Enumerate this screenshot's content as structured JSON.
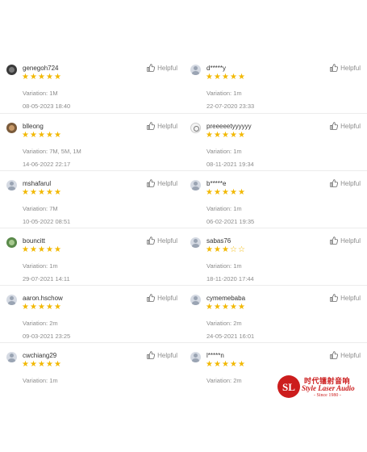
{
  "helpful_label": "Helpful",
  "star_color": "#f2b800",
  "reviews": [
    {
      "username": "genegoh724",
      "rating": 5,
      "variation": "Variation: 1M",
      "date": "08-05-2023 18:40",
      "avatar": "photo-avatar"
    },
    {
      "username": "d*****y",
      "rating": 5,
      "variation": "Variation: 1m",
      "date": "22-07-2020 23:33",
      "avatar": "default-avatar"
    },
    {
      "username": "blleong",
      "rating": 5,
      "variation": "Variation: 7M, 5M, 1M",
      "date": "14-06-2022 22:17",
      "avatar": "photo-avatar"
    },
    {
      "username": "preeeeetyyyyyy",
      "rating": 5,
      "variation": "Variation: 1m",
      "date": "08-11-2021 19:34",
      "avatar": "sketch-avatar"
    },
    {
      "username": "mshafarul",
      "rating": 5,
      "variation": "Variation: 7M",
      "date": "10-05-2022 08:51",
      "avatar": "default-avatar"
    },
    {
      "username": "b*****e",
      "rating": 5,
      "variation": "Variation: 1m",
      "date": "06-02-2021 19:35",
      "avatar": "default-avatar"
    },
    {
      "username": "bouncitt",
      "rating": 5,
      "variation": "Variation: 1m",
      "date": "29-07-2021 14:11",
      "avatar": "photo-avatar"
    },
    {
      "username": "sabas76",
      "rating": 3,
      "variation": "Variation: 1m",
      "date": "18-11-2020 17:44",
      "avatar": "default-avatar"
    },
    {
      "username": "aaron.hschow",
      "rating": 5,
      "variation": "Variation: 2m",
      "date": "09-03-2021 23:25",
      "avatar": "default-avatar"
    },
    {
      "username": "cymemebaba",
      "rating": 5,
      "variation": "Variation: 2m",
      "date": "24-05-2021 16:01",
      "avatar": "default-avatar"
    },
    {
      "username": "cwchiang29",
      "rating": 5,
      "variation": "Variation: 1m",
      "date": "",
      "avatar": "default-avatar"
    },
    {
      "username": "l*****n",
      "rating": 5,
      "variation": "Variation: 2m",
      "date": "",
      "avatar": "default-avatar"
    }
  ],
  "logo": {
    "chinese": "时代镭射音响",
    "english": "Style Laser Audio",
    "since": "- Since 1980 -",
    "color": "#cc1d1d"
  }
}
